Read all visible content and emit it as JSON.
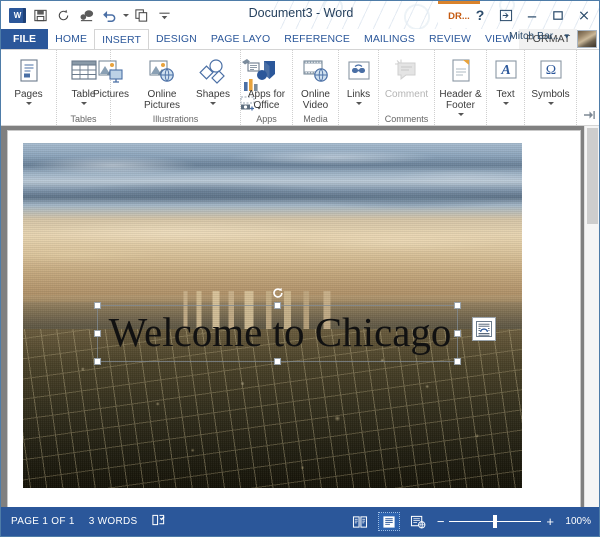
{
  "window": {
    "document_title": "Document3 - Word",
    "contextual_tab": "DR...",
    "quick_access": [
      {
        "name": "word-logo",
        "label": "W"
      },
      {
        "name": "save",
        "label": "Save"
      },
      {
        "name": "repeat",
        "label": "Repeat"
      },
      {
        "name": "touch-mode",
        "label": "Touch/Mouse Mode"
      },
      {
        "name": "undo",
        "label": "Undo"
      },
      {
        "name": "redo-copy",
        "label": "Repeat Typing"
      },
      {
        "name": "customize",
        "label": "Customize Quick Access Toolbar"
      }
    ],
    "controls": {
      "help": "?",
      "ribbon_display": "Ribbon Display Options",
      "minimize": "Minimize",
      "maximize": "Restore Down",
      "close": "Close"
    }
  },
  "tabs": [
    {
      "label": "FILE",
      "state": "file"
    },
    {
      "label": "HOME",
      "state": "normal"
    },
    {
      "label": "INSERT",
      "state": "active"
    },
    {
      "label": "DESIGN",
      "state": "normal"
    },
    {
      "label": "PAGE LAYO",
      "state": "normal"
    },
    {
      "label": "REFERENCE",
      "state": "normal"
    },
    {
      "label": "MAILINGS",
      "state": "normal"
    },
    {
      "label": "REVIEW",
      "state": "normal"
    },
    {
      "label": "VIEW",
      "state": "normal"
    },
    {
      "label": "FORMAT",
      "state": "contextual"
    }
  ],
  "account": {
    "user_name": "Mitch Bar...",
    "dropdown": "▾"
  },
  "ribbon": {
    "groups": [
      {
        "name": "Pages",
        "label": "",
        "buttons": [
          {
            "label": "Pages",
            "icon": "page-icon",
            "dropdown": true
          }
        ]
      },
      {
        "name": "Tables",
        "label": "Tables",
        "buttons": [
          {
            "label": "Table",
            "icon": "table-icon",
            "dropdown": true
          }
        ]
      },
      {
        "name": "Illustrations",
        "label": "Illustrations",
        "buttons": [
          {
            "label": "Pictures",
            "icon": "pictures-icon",
            "dropdown": false
          },
          {
            "label": "Online Pictures",
            "icon": "online-pictures-icon",
            "dropdown": false
          },
          {
            "label": "Shapes",
            "icon": "shapes-icon",
            "dropdown": true
          }
        ],
        "small_buttons": [
          {
            "label": "SmartArt",
            "icon": "smartart-icon"
          },
          {
            "label": "Chart",
            "icon": "chart-icon"
          },
          {
            "label": "Screenshot",
            "icon": "screenshot-icon"
          }
        ]
      },
      {
        "name": "Apps",
        "label": "Apps",
        "buttons": [
          {
            "label": "Apps for Office",
            "icon": "apps-icon",
            "dropdown": true
          }
        ]
      },
      {
        "name": "Media",
        "label": "Media",
        "buttons": [
          {
            "label": "Online Video",
            "icon": "video-icon",
            "dropdown": false
          }
        ]
      },
      {
        "name": "Links",
        "label": "",
        "buttons": [
          {
            "label": "Links",
            "icon": "links-icon",
            "dropdown": true
          }
        ]
      },
      {
        "name": "Comments",
        "label": "Comments",
        "buttons": [
          {
            "label": "Comment",
            "icon": "comment-icon",
            "dropdown": false,
            "disabled": true
          }
        ]
      },
      {
        "name": "HeaderFooter",
        "label": "",
        "buttons": [
          {
            "label": "Header & Footer",
            "icon": "header-footer-icon",
            "dropdown": true
          }
        ]
      },
      {
        "name": "Text",
        "label": "",
        "buttons": [
          {
            "label": "Text",
            "icon": "text-icon",
            "dropdown": true
          }
        ]
      },
      {
        "name": "Symbols",
        "label": "",
        "buttons": [
          {
            "label": "Symbols",
            "icon": "omega-icon",
            "dropdown": true
          }
        ]
      }
    ],
    "collapse_button": "collapse-ribbon-pin-icon"
  },
  "document": {
    "textbox_text": "Welcome to Chicago",
    "image_alt": "Chicago skyline aerial photo",
    "layout_options_icon": "layout-options-icon",
    "rotation_handle_icon": "rotate-icon",
    "selection_handles": 8
  },
  "status_bar": {
    "page_indicator": "PAGE 1 OF 1",
    "word_count": "3 WORDS",
    "proofing_icon": "proofing-errors-icon",
    "views": [
      {
        "name": "read-mode",
        "label": "Read Mode",
        "selected": false
      },
      {
        "name": "print-layout",
        "label": "Print Layout",
        "selected": true
      },
      {
        "name": "web-layout",
        "label": "Web Layout",
        "selected": false
      }
    ],
    "zoom_out": "−",
    "zoom_in": "+",
    "zoom_level": "100%"
  },
  "colors": {
    "accent": "#2b579a",
    "contextual_tab": "#d9822b",
    "workspace": "#808080",
    "page": "#ffffff"
  }
}
